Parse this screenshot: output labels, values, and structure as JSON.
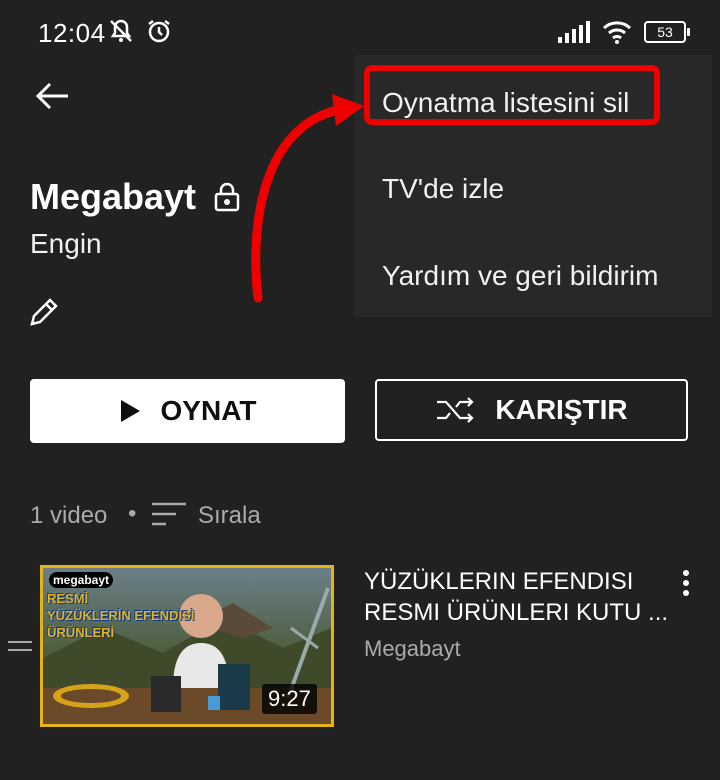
{
  "status_bar": {
    "time": "12:04",
    "battery": "53",
    "icons_left": [
      "mute-notification-icon",
      "alarm-icon"
    ],
    "icons_right": [
      "signal-icon",
      "wifi-icon",
      "battery-icon"
    ]
  },
  "header": {
    "back_icon": "back-arrow-icon"
  },
  "playlist": {
    "title": "Megabayt",
    "owner": "Engin",
    "privacy_icon": "lock-icon",
    "edit_icon": "pencil-icon",
    "play_label": "OYNAT",
    "shuffle_label": "KARIŞTIR",
    "count": "1 video",
    "separator": "•",
    "sort_label": "Sırala"
  },
  "menu": {
    "items": [
      {
        "label": "Oynatma listesini sil"
      },
      {
        "label": "TV'de izle"
      },
      {
        "label": "Yardım ve geri bildirim"
      }
    ],
    "annotation_color": "#e00000"
  },
  "video": {
    "title": "YÜZÜKLERIN EFENDISI RESMI ÜRÜNLERI KUTU ...",
    "channel": "Megabayt",
    "duration": "9:27",
    "thumb_brand": "megabayt",
    "thumb_text": [
      "RESMİ",
      "YÜZÜKLERİN EFENDİSİ",
      "ÜRÜNLERİ"
    ]
  }
}
